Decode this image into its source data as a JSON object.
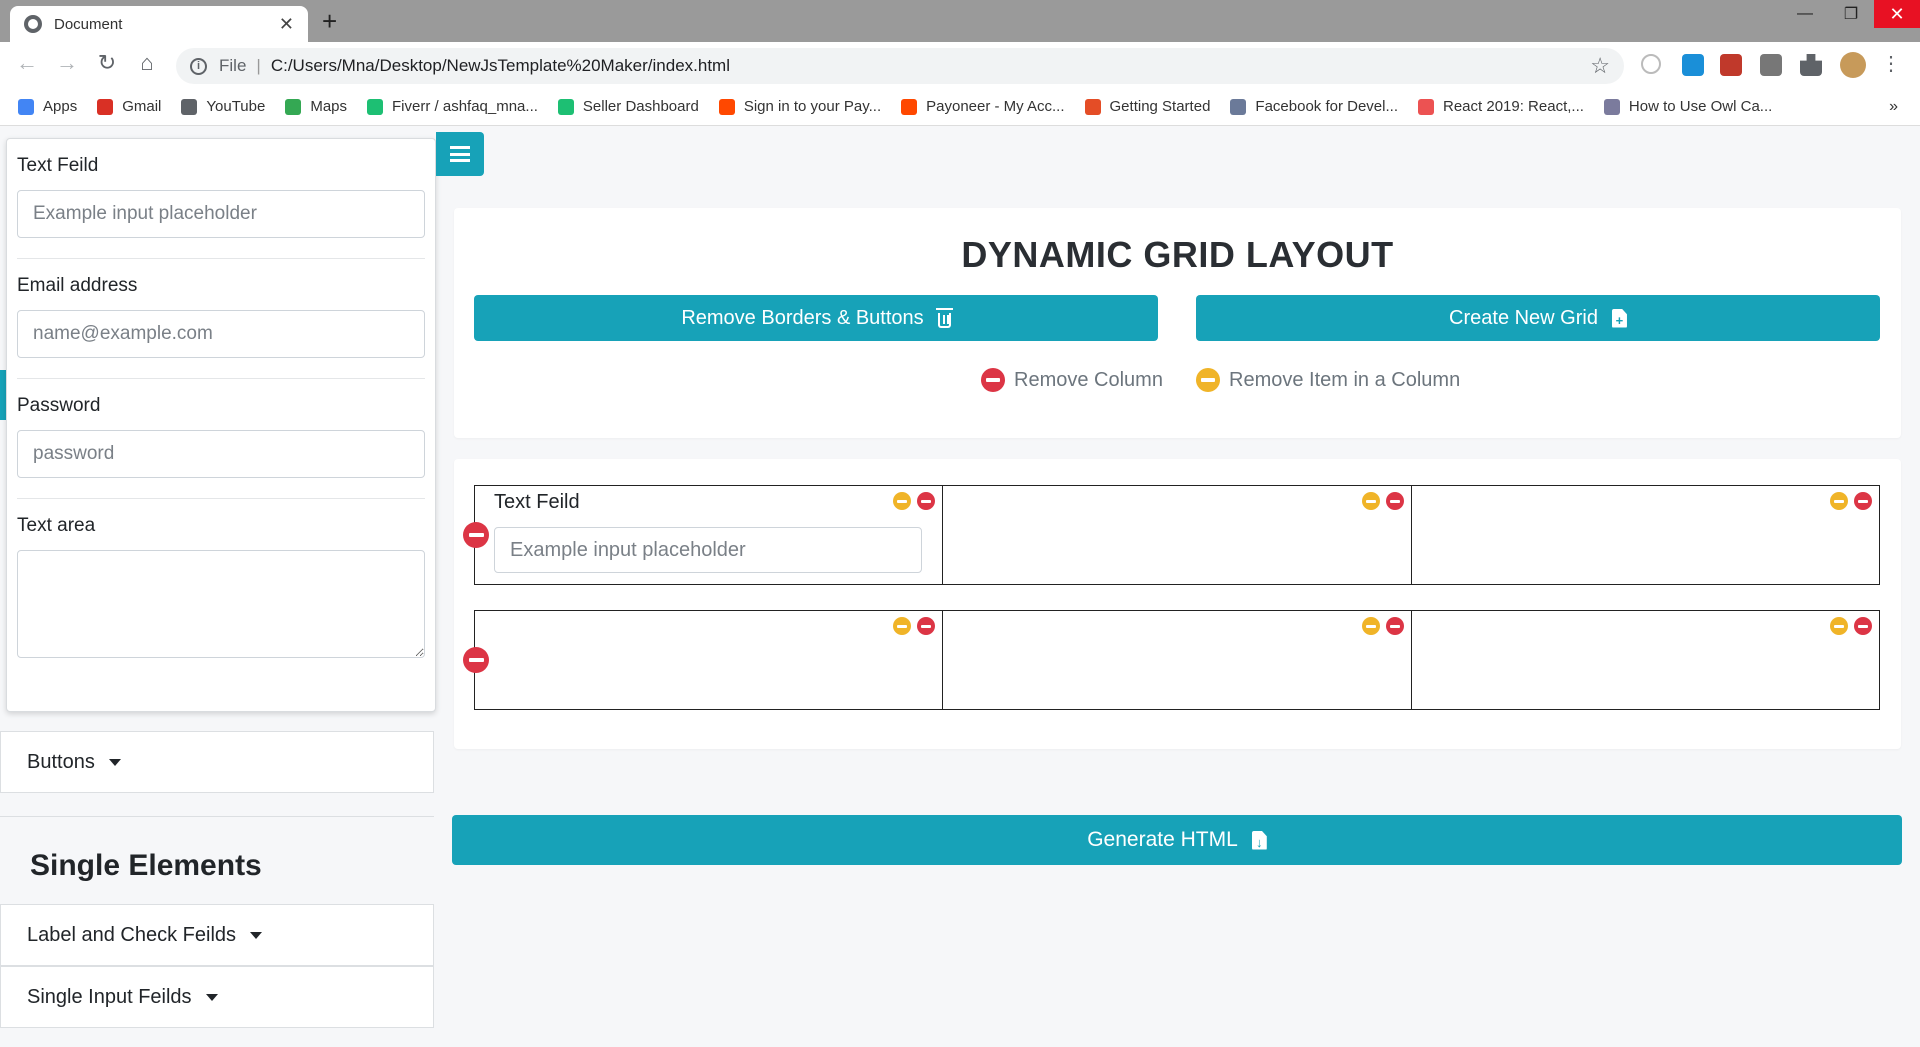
{
  "browser": {
    "tab_title": "Document",
    "url_scheme": "File",
    "url": "C:/Users/Mna/Desktop/NewJsTemplate%20Maker/index.html",
    "bookmarks": [
      {
        "label": "Apps",
        "icon": "apps-grid-icon",
        "color": "#4285f4"
      },
      {
        "label": "Gmail",
        "icon": "gmail-icon",
        "color": "#d93025"
      },
      {
        "label": "YouTube",
        "icon": "globe-icon",
        "color": "#5f6368"
      },
      {
        "label": "Maps",
        "icon": "maps-icon",
        "color": "#34a853"
      },
      {
        "label": "Fiverr / ashfaq_mna...",
        "icon": "fiverr-icon",
        "color": "#1dbf73"
      },
      {
        "label": "Seller Dashboard",
        "icon": "fiverr-icon",
        "color": "#1dbf73"
      },
      {
        "label": "Sign in to your Pay...",
        "icon": "payoneer-icon",
        "color": "#ff4800"
      },
      {
        "label": "Payoneer - My Acc...",
        "icon": "payoneer-icon",
        "color": "#ff4800"
      },
      {
        "label": "Getting Started",
        "icon": "angular-icon",
        "color": "#e44d26"
      },
      {
        "label": "Facebook for Devel...",
        "icon": "fb-text-icon",
        "color": "#6b7a99"
      },
      {
        "label": "React 2019: React,...",
        "icon": "udemy-icon",
        "color": "#ec5252"
      },
      {
        "label": "How to Use Owl Ca...",
        "icon": "owl-icon",
        "color": "#7b7b9d"
      }
    ]
  },
  "sidebar": {
    "panel_fields": {
      "text_label": "Text Feild",
      "text_placeholder": "Example input placeholder",
      "email_label": "Email address",
      "email_placeholder": "name@example.com",
      "password_label": "Password",
      "password_placeholder": "password",
      "textarea_label": "Text area"
    },
    "buttons_item": "Buttons",
    "single_heading": "Single Elements",
    "label_check_item": "Label and Check Feilds",
    "single_input_item": "Single Input Feilds"
  },
  "main": {
    "title": "DYNAMIC GRID LAYOUT",
    "remove_borders_label": "Remove Borders & Buttons",
    "create_grid_label": "Create New Grid",
    "legend_remove_column": "Remove Column",
    "legend_remove_item": "Remove Item in a Column",
    "grid_cell_label": "Text Feild",
    "grid_cell_placeholder": "Example input placeholder",
    "generate_label": "Generate HTML"
  },
  "colors": {
    "accent": "#17a2b8",
    "danger": "#dc3545",
    "warning": "#f0b428"
  }
}
